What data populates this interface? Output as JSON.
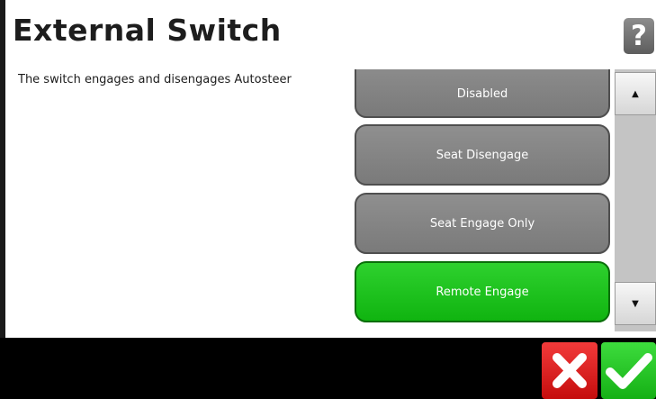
{
  "header": {
    "title": "External Switch",
    "help_label": "?"
  },
  "description": "The switch engages and disengages Autosteer",
  "options": [
    {
      "label": "Disabled",
      "selected": false
    },
    {
      "label": "Seat Disengage",
      "selected": false
    },
    {
      "label": "Seat Engage Only",
      "selected": false
    },
    {
      "label": "Remote Engage",
      "selected": true
    }
  ],
  "scroll": {
    "up_icon": "triangle-up-icon",
    "down_icon": "triangle-down-icon"
  },
  "footer": {
    "cancel_icon": "cross-icon",
    "confirm_icon": "check-icon"
  },
  "colors": {
    "selected": "#1fc41f",
    "unselected": "#858585",
    "cancel": "#e02020",
    "confirm": "#22c422"
  }
}
